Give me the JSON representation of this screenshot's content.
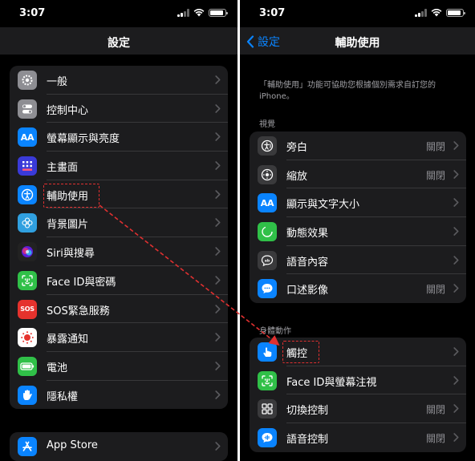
{
  "left": {
    "time": "3:07",
    "nav_title": "設定",
    "items": [
      {
        "label": "一般",
        "icon": "gear-icon",
        "color": "#8e8e93"
      },
      {
        "label": "控制中心",
        "icon": "toggles-icon",
        "color": "#8e8e93"
      },
      {
        "label": "螢幕顯示與亮度",
        "icon": "text-size-icon",
        "color": "#0a84ff",
        "glyph": "AA"
      },
      {
        "label": "主畫面",
        "icon": "home-grid-icon",
        "color": "#3a3ad8"
      },
      {
        "label": "輔助使用",
        "icon": "accessibility-icon",
        "color": "#0a84ff"
      },
      {
        "label": "背景圖片",
        "icon": "flower-icon",
        "color": "#30a0e0"
      },
      {
        "label": "Siri與搜尋",
        "icon": "siri-icon",
        "color": "#222222"
      },
      {
        "label": "Face ID與密碼",
        "icon": "face-id-icon",
        "color": "#30c048"
      },
      {
        "label": "SOS緊急服務",
        "icon": "sos-icon",
        "color": "#e5322d",
        "glyph": "SOS"
      },
      {
        "label": "暴露通知",
        "icon": "exposure-icon",
        "color": "#ffffff"
      },
      {
        "label": "電池",
        "icon": "battery-icon",
        "color": "#30c048"
      },
      {
        "label": "隱私權",
        "icon": "hand-icon",
        "color": "#0a84ff"
      }
    ],
    "store_items": [
      {
        "label": "App Store",
        "icon": "app-store-icon",
        "color": "#0a84ff"
      }
    ]
  },
  "right": {
    "time": "3:07",
    "nav_title": "輔助使用",
    "back_label": "設定",
    "description": "「輔助使用」功能可協助您根據個別需求自訂您的iPhone。",
    "vision_header": "視覺",
    "vision_items": [
      {
        "label": "旁白",
        "value": "關閉",
        "icon": "voiceover-icon",
        "color": "#3a3a3c"
      },
      {
        "label": "縮放",
        "value": "關閉",
        "icon": "zoom-icon",
        "color": "#3a3a3c"
      },
      {
        "label": "顯示與文字大小",
        "value": "",
        "icon": "text-size-icon",
        "color": "#0a84ff",
        "glyph": "AA"
      },
      {
        "label": "動態效果",
        "value": "",
        "icon": "motion-icon",
        "color": "#30c048"
      },
      {
        "label": "語音內容",
        "value": "",
        "icon": "spoken-content-icon",
        "color": "#3a3a3c"
      },
      {
        "label": "口述影像",
        "value": "關閉",
        "icon": "audio-description-icon",
        "color": "#0a84ff"
      }
    ],
    "physical_header": "身體動作",
    "physical_items": [
      {
        "label": "觸控",
        "value": "",
        "icon": "touch-icon",
        "color": "#0a84ff"
      },
      {
        "label": "Face ID與螢幕注視",
        "value": "",
        "icon": "face-id-icon",
        "color": "#30c048"
      },
      {
        "label": "切換控制",
        "value": "關閉",
        "icon": "switch-control-icon",
        "color": "#3a3a3c"
      },
      {
        "label": "語音控制",
        "value": "關閉",
        "icon": "voice-control-icon",
        "color": "#0a84ff"
      }
    ]
  },
  "colors": {
    "accent": "#0a84ff",
    "highlight": "#e03030",
    "cell": "#1c1c1e",
    "secondary_text": "#8e8e93"
  }
}
